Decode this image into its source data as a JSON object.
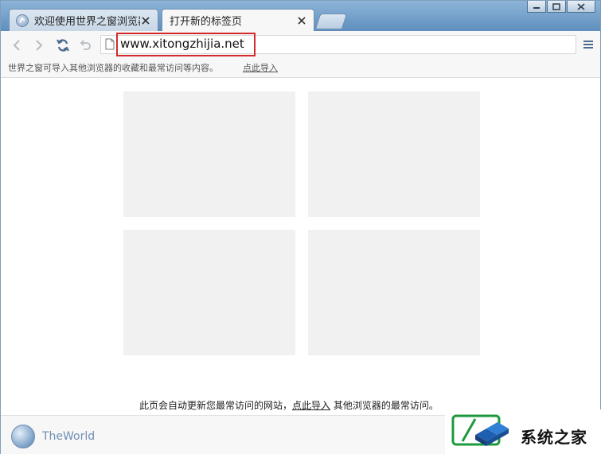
{
  "tabs": [
    {
      "label": "欢迎使用世界之窗浏览器",
      "active": false
    },
    {
      "label": "打开新的标签页",
      "active": true
    }
  ],
  "toolbar": {
    "url": "www.xitongzhijia.net"
  },
  "import_bar": {
    "text": "世界之窗可导入其他浏览器的收藏和最常访问等内容。",
    "link": "点此导入"
  },
  "content": {
    "footer_before": "此页会自动更新您最常访问的网站，",
    "footer_link": "点此导入",
    "footer_after": " 其他浏览器的最常访问。"
  },
  "status": {
    "brand": "TheWorld"
  },
  "watermark": {
    "text": "系统之家"
  },
  "colors": {
    "tab_strip": "#6d9cc7",
    "highlight": "#d22a2a",
    "tile": "#f1f1f1",
    "brand_text": "#6d8fb5"
  }
}
